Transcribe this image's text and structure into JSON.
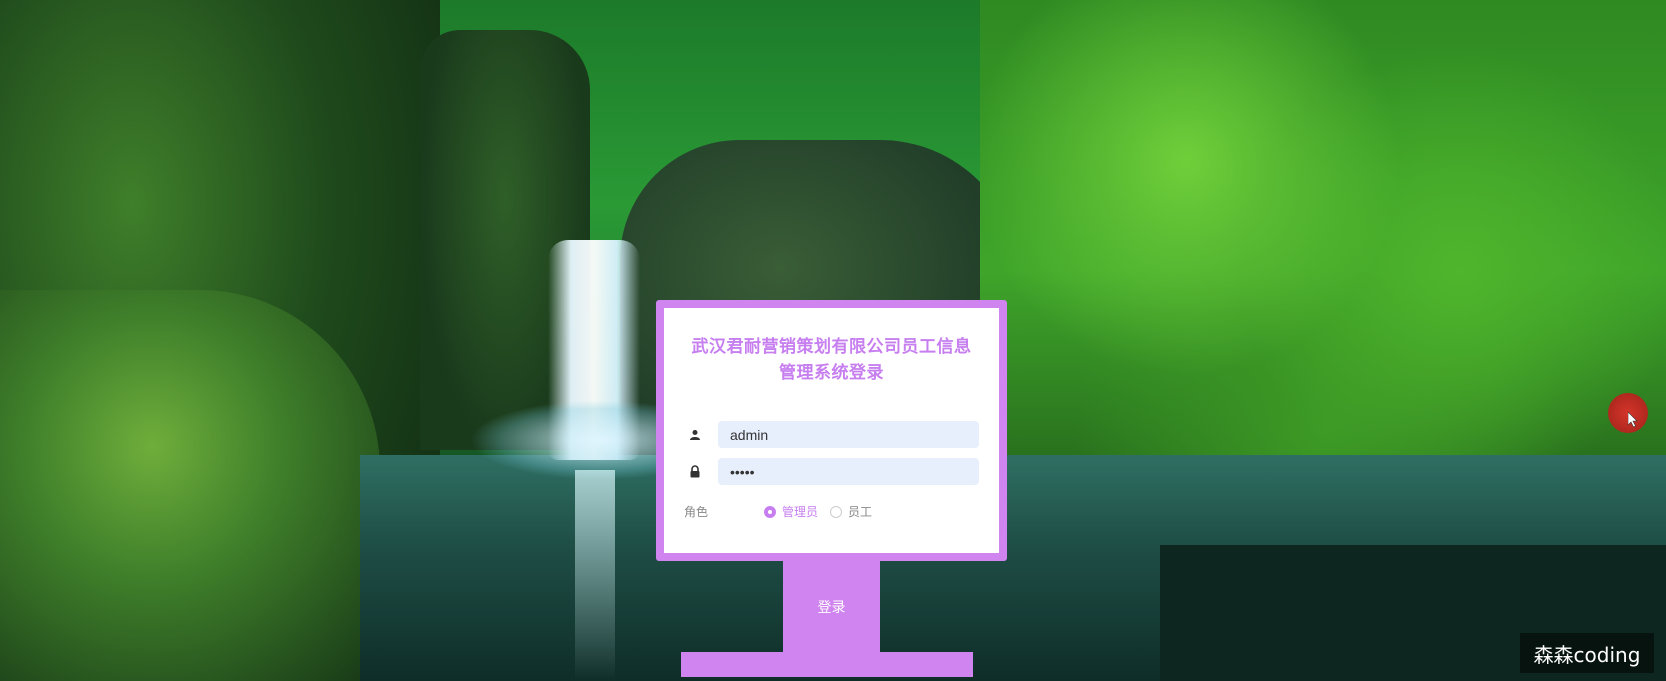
{
  "login": {
    "title": "武汉君耐营销策划有限公司员工信息管理系统登录",
    "username_value": "admin",
    "password_value": "admin",
    "role_label": "角色",
    "roles": [
      "管理员",
      "员工"
    ],
    "selected_role": "管理员",
    "submit_label": "登录"
  },
  "icons": {
    "username": "user-icon",
    "password": "lock-icon",
    "cursor": "mouse-pointer-icon"
  },
  "colors": {
    "accent": "#cf84f0",
    "title": "#c77ff0",
    "input_bg": "#e8effc"
  },
  "watermark": "森森coding"
}
